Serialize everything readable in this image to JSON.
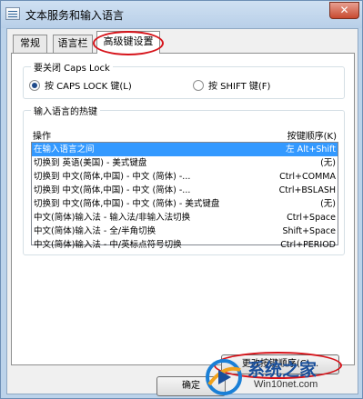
{
  "window": {
    "title": "文本服务和输入语言",
    "close_label": "✕"
  },
  "tabs": [
    {
      "label": "常规",
      "active": false
    },
    {
      "label": "语言栏",
      "active": false
    },
    {
      "label": "高级键设置",
      "active": true
    }
  ],
  "caps_lock": {
    "legend": "要关闭 Caps Lock",
    "option_caps": {
      "label": "按 CAPS LOCK 键(L)",
      "checked": true
    },
    "option_shift": {
      "label": "按 SHIFT 键(F)",
      "checked": false
    }
  },
  "hotkeys": {
    "legend": "输入语言的热键",
    "col_action": "操作",
    "col_keys": "按键顺序(K)",
    "rows": [
      {
        "action": "在输入语言之间",
        "keys": "左 Alt+Shift",
        "selected": true
      },
      {
        "action": "切换到 英语(美国) - 美式键盘",
        "keys": "(无)",
        "selected": false
      },
      {
        "action": "切换到 中文(简体,中国) - 中文 (简体) -...",
        "keys": "Ctrl+COMMA",
        "selected": false
      },
      {
        "action": "切换到 中文(简体,中国) - 中文 (简体) -...",
        "keys": "Ctrl+BSLASH",
        "selected": false
      },
      {
        "action": "切换到 中文(简体,中国) - 中文 (简体) - 美式键盘",
        "keys": "(无)",
        "selected": false
      },
      {
        "action": "中文(简体)输入法 - 输入法/非输入法切换",
        "keys": "Ctrl+Space",
        "selected": false
      },
      {
        "action": "中文(简体)输入法 - 全/半角切换",
        "keys": "Shift+Space",
        "selected": false
      },
      {
        "action": "中文(简体)输入法 - 中/英标点符号切换",
        "keys": "Ctrl+PERIOD",
        "selected": false
      }
    ]
  },
  "buttons": {
    "change_sequence": "更改按键顺序(C)...",
    "ok": "确定"
  },
  "watermark": {
    "title": "系统之家",
    "subtitle": "Win10net.com"
  },
  "colors": {
    "annotation_red": "#d6131a",
    "selection_blue": "#3399ff"
  }
}
